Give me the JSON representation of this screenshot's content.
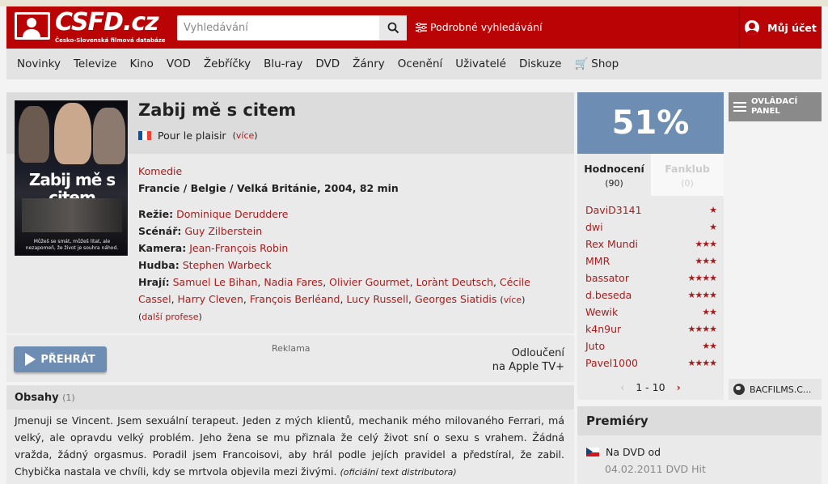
{
  "header": {
    "logo_text": "CSFD.cz",
    "logo_sub": "Česko-Slovenská filmová databáze",
    "search_placeholder": "Vyhledávání",
    "advanced_search": "Podrobné vyhledávání",
    "account": "Můj účet"
  },
  "nav": {
    "items": [
      "Novinky",
      "Televize",
      "Kino",
      "VOD",
      "Žebříčky",
      "Blu-ray",
      "DVD",
      "Žánry",
      "Ocenění",
      "Uživatelé",
      "Diskuze",
      "Shop"
    ]
  },
  "film": {
    "title": "Zabij mě s citem",
    "poster_title": "Zabij mě s citem",
    "poster_tagline": "Můžeš se smát, můžeš litat, ale nezapomeň, že život je souhra náhod.",
    "original_title": "Pour le plaisir",
    "more": "více",
    "genre": "Komedie",
    "origin": "Francie / Belgie / Velká Británie, 2004, 82 min",
    "director_label": "Režie:",
    "director": "Dominique Deruddere",
    "writer_label": "Scénář:",
    "writer": "Guy Zilberstein",
    "camera_label": "Kamera:",
    "camera": "Jean-François Robin",
    "music_label": "Hudba:",
    "music": "Stephen Warbeck",
    "cast_label": "Hrají:",
    "cast": [
      "Samuel Le Bihan",
      "Nadia Fares",
      "Olivier Gourmet",
      "Lorànt Deutsch",
      "Cécile Cassel",
      "Harry Cleven",
      "François Berléand",
      "Lucy Russell",
      "Georges Siatidis"
    ],
    "cast_more": "více",
    "more_professions": "další profese",
    "flag_colors": [
      "#0055a4",
      "#ffffff",
      "#ef4135"
    ]
  },
  "player": {
    "play_label": "PŘEHRÁT",
    "ad_label": "Reklama",
    "apple_line1": "Odloučení",
    "apple_line2": "na Apple TV+"
  },
  "synopsis": {
    "title": "Obsahy",
    "count": "(1)",
    "text": "Jmenuji se Vincent. Jsem sexuální terapeut. Jeden z mých klientů, mechanik mého milovaného Ferrari, má velký, ale opravdu velký problém. Jeho žena se mu přiznala že celý život sní o sexu s vrahem. Žádná vražda, žádný orgasmus. Poradil jsem Francoisovi, aby hrál podle jejích pravidel a předstíral, že zabil. Chybička nastala ve chvíli, kdy se mrtvola objevila mezi živými.",
    "source": "(oficiální text distributora)"
  },
  "rating": {
    "percent": "51%",
    "tab1_label": "Hodnocení",
    "tab1_count": "(90)",
    "tab2_label": "Fanklub",
    "tab2_count": "(0)",
    "users": [
      {
        "name": "DaviD3141",
        "stars": "★"
      },
      {
        "name": "dwi",
        "stars": "★"
      },
      {
        "name": "Rex Mundi",
        "stars": "★★★"
      },
      {
        "name": "MMR",
        "stars": "★★★"
      },
      {
        "name": "bassator",
        "stars": "★★★★"
      },
      {
        "name": "d.beseda",
        "stars": "★★★★"
      },
      {
        "name": "Wewik",
        "stars": "★★"
      },
      {
        "name": "k4n9ur",
        "stars": "★★★★"
      },
      {
        "name": "Juto",
        "stars": "★★"
      },
      {
        "name": "Pavel1000",
        "stars": "★★★★"
      }
    ],
    "pager": "1 - 10"
  },
  "side": {
    "control_panel": "OVLÁDACÍ PANEL",
    "distributor": "BACFILMS.C..."
  },
  "premieres": {
    "title": "Premiéry",
    "line": "Na DVD od",
    "date": "04.02.2011 DVD Hit"
  }
}
